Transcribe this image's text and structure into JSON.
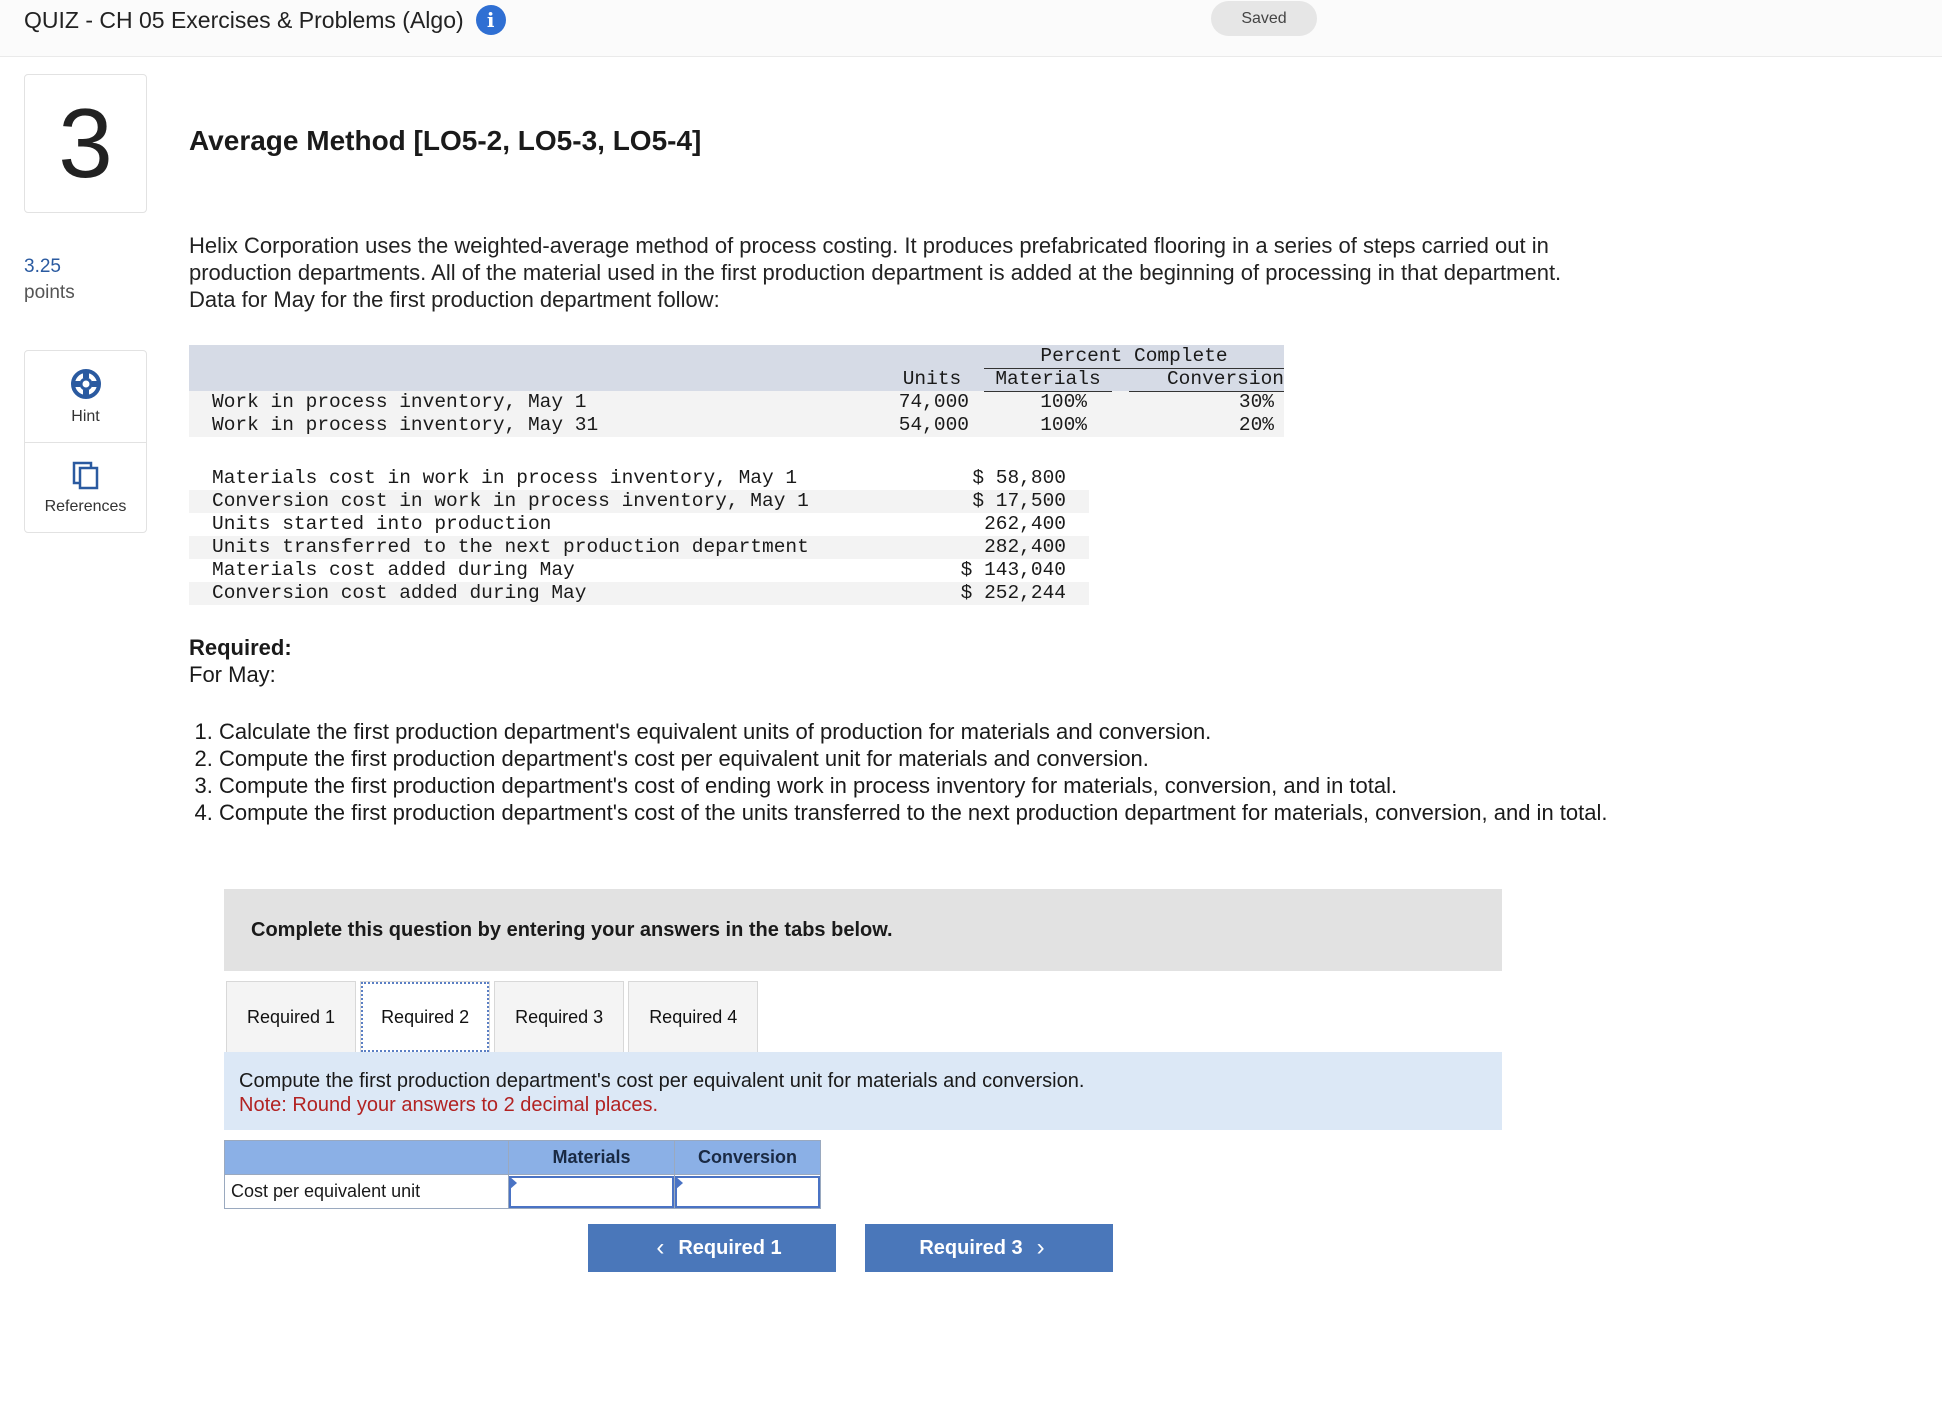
{
  "header": {
    "quiz_title": "QUIZ - CH 05 Exercises & Problems (Algo)",
    "info_glyph": "i",
    "saved_label": "Saved"
  },
  "question": {
    "number": "3",
    "points_value": "3.25",
    "points_label": "points",
    "title": "Average Method [LO5-2, LO5-3, LO5-4]",
    "intro": "Helix Corporation uses the weighted-average method of process costing. It produces prefabricated flooring in a series of steps carried out in production departments. All of the material used in the first production department is added at the beginning of processing in that department. Data for May for the first production department follow:"
  },
  "tools": {
    "hint_label": "Hint",
    "references_label": "References"
  },
  "inventory_table": {
    "percent_header": "Percent Complete",
    "col_units": "Units",
    "col_materials": "Materials",
    "col_conversion": "Conversion",
    "rows": [
      {
        "label": "Work in process inventory, May 1",
        "units": "74,000",
        "materials": "100%",
        "conversion": "30%"
      },
      {
        "label": "Work in process inventory, May 31",
        "units": "54,000",
        "materials": "100%",
        "conversion": "20%"
      }
    ]
  },
  "cost_table": {
    "rows": [
      {
        "label": "Materials cost in work in process inventory, May 1",
        "value": "$ 58,800"
      },
      {
        "label": "Conversion cost in work in process inventory, May 1",
        "value": "$ 17,500"
      },
      {
        "label": "Units started into production",
        "value": "262,400"
      },
      {
        "label": "Units transferred to the next production department",
        "value": "282,400"
      },
      {
        "label": "Materials cost added during May",
        "value": "$ 143,040"
      },
      {
        "label": "Conversion cost added during May",
        "value": "$ 252,244"
      }
    ]
  },
  "required": {
    "heading": "Required:",
    "subheading": "For May:",
    "steps": [
      "Calculate the first production department's equivalent units of production for materials and conversion.",
      "Compute the first production department's cost per equivalent unit for materials and conversion.",
      "Compute the first production department's cost of ending work in process inventory for materials, conversion, and in total.",
      "Compute the first production department's cost of the units transferred to the next production department for materials, conversion, and in total."
    ]
  },
  "answer_panel": {
    "banner": "Complete this question by entering your answers in the tabs below.",
    "tabs": [
      "Required 1",
      "Required 2",
      "Required 3",
      "Required 4"
    ],
    "active_tab": "Required 2",
    "instruction": "Compute the first production department's cost per equivalent unit for materials and conversion.",
    "note": "Note: Round your answers to 2 decimal places.",
    "table_headers": [
      "",
      "Materials",
      "Conversion"
    ],
    "row_label": "Cost per equivalent unit",
    "materials_value": "",
    "conversion_value": "",
    "prev_button": "Required 1",
    "next_button": "Required 3"
  },
  "colors": {
    "accent_blue": "#4a77ba",
    "header_blue": "#8bb0e6",
    "note_red": "#b22222",
    "instruction_bg": "#dce8f6"
  }
}
